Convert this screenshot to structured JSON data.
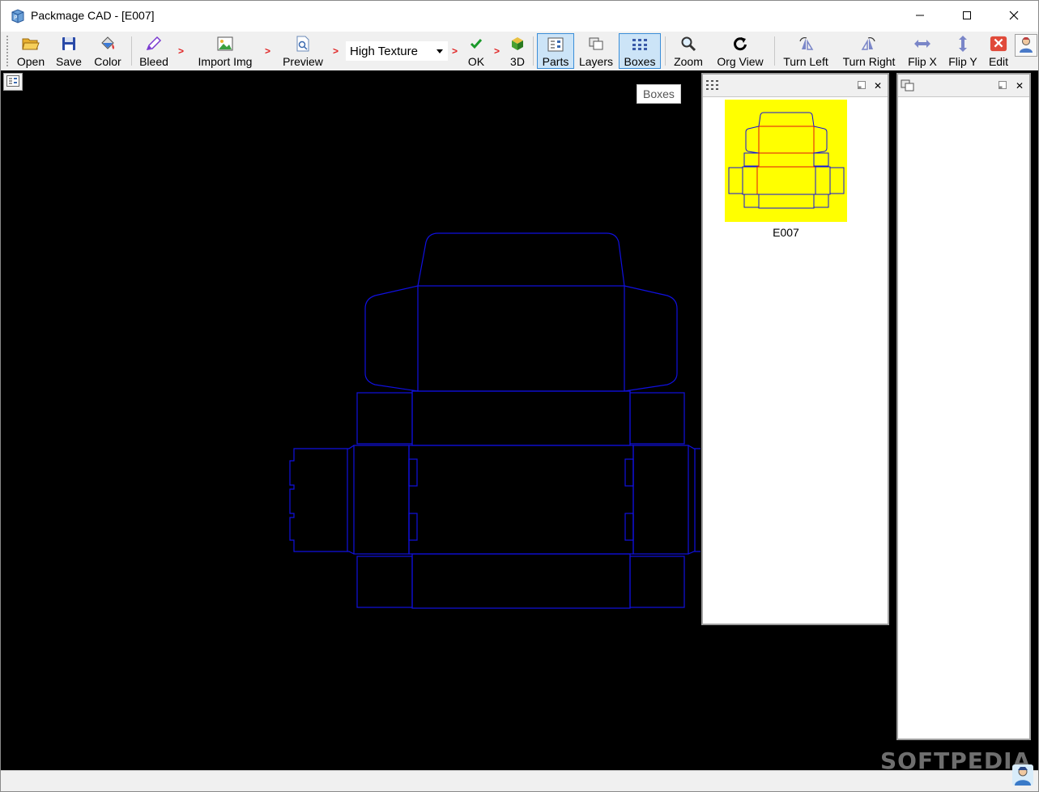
{
  "window": {
    "title": "Packmage CAD - [E007]"
  },
  "toolbar": {
    "open": "Open",
    "save": "Save",
    "color": "Color",
    "bleed": "Bleed",
    "import_img": "Import Img",
    "preview": "Preview",
    "texture_value": "High Texture",
    "ok": "OK",
    "three_d": "3D",
    "parts": "Parts",
    "layers": "Layers",
    "boxes": "Boxes",
    "zoom": "Zoom",
    "org_view": "Org View",
    "turn_left": "Turn Left",
    "turn_right": "Turn Right",
    "flip_x": "Flip X",
    "flip_y": "Flip Y",
    "edit": "Edit",
    "step_arrow": ">",
    "overflow": "▾"
  },
  "tooltip": {
    "text": "Boxes"
  },
  "boxes_panel": {
    "items": [
      {
        "label": "E007"
      }
    ],
    "close": "✕"
  },
  "layers_panel": {
    "close": "✕"
  },
  "watermark": {
    "text": "SOFTPEDIA"
  },
  "colors": {
    "dieline_cut": "#1010e0",
    "dieline_fold": "#e01010",
    "thumb_bg": "#ffff00",
    "canvas_bg": "#000000",
    "active_button": "#cce4f7"
  }
}
